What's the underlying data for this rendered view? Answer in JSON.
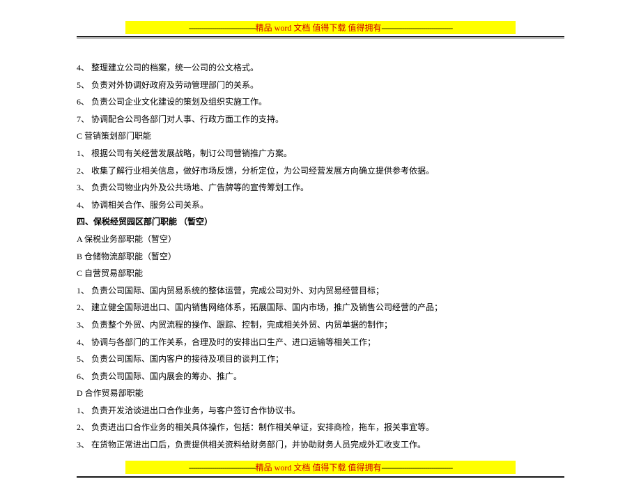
{
  "banner": {
    "dash_left": "--------------------------------",
    "text_prefix": "精品 ",
    "text_word": "word",
    "text_suffix": " 文档   值得下载   值得拥有",
    "dash_right": "----------------------------------"
  },
  "body": {
    "l1": "4、  整理建立公司的档案，统一公司的公文格式。",
    "l2": "5、  负责对外协调好政府及劳动管理部门的关系。",
    "l3": "6、  负责公司企业文化建设的策划及组织实施工作。",
    "l4": "7、  协调配合公司各部门对人事、行政方面工作的支持。",
    "l5": "C   营销策划部门职能",
    "l6": "1、  根据公司有关经营发展战略，制订公司营销推广方案。",
    "l7": "2、  收集了解行业相关信息，做好市场反馈，分析定位，为公司经营发展方向确立提供参考依据。",
    "l8": "3、  负责公司物业内外及公共场地、广告牌等的宣传筹划工作。",
    "l9": "4、  协调相关合作、服务公司关系。",
    "sec4_title": "四、保税经贸园区部门职能  （暂空）",
    "l10": "A   保税业务部职能（暂空）",
    "l11": "B   仓储物流部职能（暂空）",
    "l12": "C   自营贸易部职能",
    "l13": "1、  负责公司国际、国内贸易系统的整体运营，完成公司对外、对内贸易经营目标；",
    "l14": "2、  建立健全国际进出口、国内销售网络体系，拓展国际、国内市场，推广及销售公司经营的产品；",
    "l15": "3、  负责整个外贸、内贸流程的操作、跟踪、控制，完成相关外贸、内贸单据的制作；",
    "l16": "4、  协调与各部门的工作关系，合理及时的安排出口生产、进口运输等相关工作；",
    "l17": "5、  负责公司国际、国内客户的接待及项目的谈判工作；",
    "l18": "6、  负责公司国际、国内展会的筹办、推广。",
    "l19": "D   合作贸易部职能",
    "l20": "1、  负责开发洽谈进出口合作业务，与客户签订合作协议书。",
    "l21": "2、  负责进出口合作业务的相关具体操作，包括：制作相关单证，安排商检，拖车，报关事宜等。",
    "l22": "3、  在货物正常进出口后，负责提供相关资料给财务部门，并协助财务人员完成外汇收支工作。"
  }
}
